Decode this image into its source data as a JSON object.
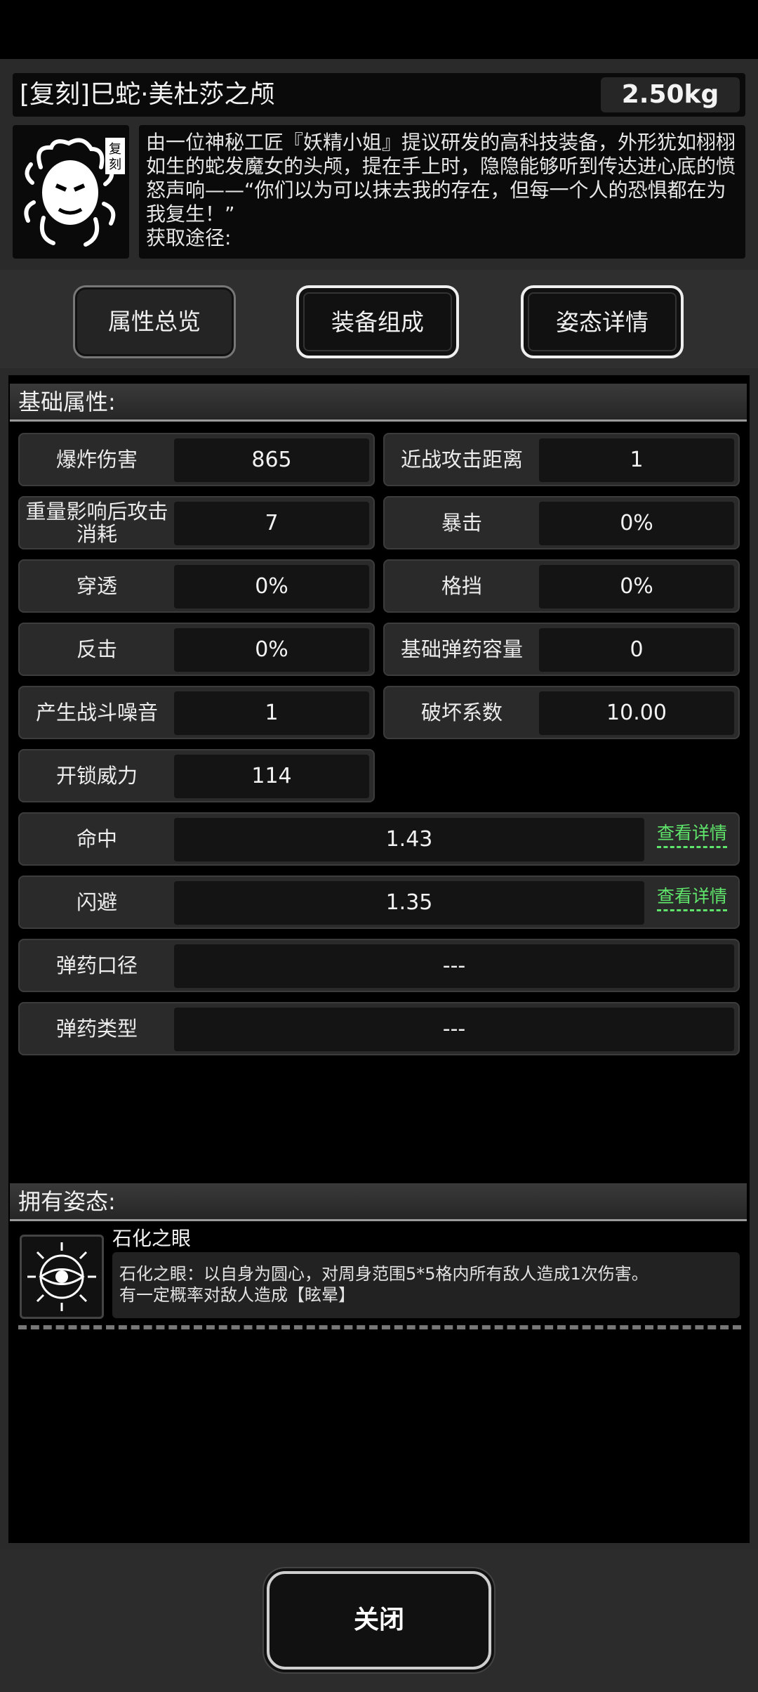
{
  "header": {
    "title": "[复刻]巳蛇·美杜莎之颅",
    "weight": "2.50kg",
    "icon_badge": "复刻"
  },
  "description": {
    "text": "由一位神秘工匠『妖精小姐』提议研发的高科技装备，外形犹如栩栩如生的蛇发魔女的头颅，提在手上时，隐隐能够听到传达进心底的愤怒声响——“你们以为可以抹去我的存在，但每一个人的恐惧都在为我复生！”",
    "source_label": "获取途径:"
  },
  "tabs": [
    {
      "label": "属性总览"
    },
    {
      "label": "装备组成"
    },
    {
      "label": "姿态详情"
    }
  ],
  "basic_section": {
    "title": "基础属性:"
  },
  "stats": [
    {
      "label": "爆炸伤害",
      "value": "865"
    },
    {
      "label": "近战攻击距离",
      "value": "1"
    },
    {
      "label": "重量影响后攻击消耗",
      "value": "7"
    },
    {
      "label": "暴击",
      "value": "0%"
    },
    {
      "label": "穿透",
      "value": "0%"
    },
    {
      "label": "格挡",
      "value": "0%"
    },
    {
      "label": "反击",
      "value": "0%"
    },
    {
      "label": "基础弹药容量",
      "value": "0"
    },
    {
      "label": "产生战斗噪音",
      "value": "1"
    },
    {
      "label": "破坏系数",
      "value": "10.00"
    },
    {
      "label": "开锁威力",
      "value": "114"
    }
  ],
  "wide_stats": [
    {
      "label": "命中",
      "value": "1.43",
      "link": "查看详情"
    },
    {
      "label": "闪避",
      "value": "1.35",
      "link": "查看详情"
    },
    {
      "label": "弹药口径",
      "value": "---"
    },
    {
      "label": "弹药类型",
      "value": "---"
    }
  ],
  "stance_section": {
    "title": "拥有姿态:"
  },
  "stance": {
    "name": "石化之眼",
    "desc_line1": "石化之眼：以自身为圆心，对周身范围5*5格内所有敌人造成1次伤害。",
    "desc_line2": "有一定概率对敌人造成【眩晕】"
  },
  "footer": {
    "close_label": "关闭"
  }
}
